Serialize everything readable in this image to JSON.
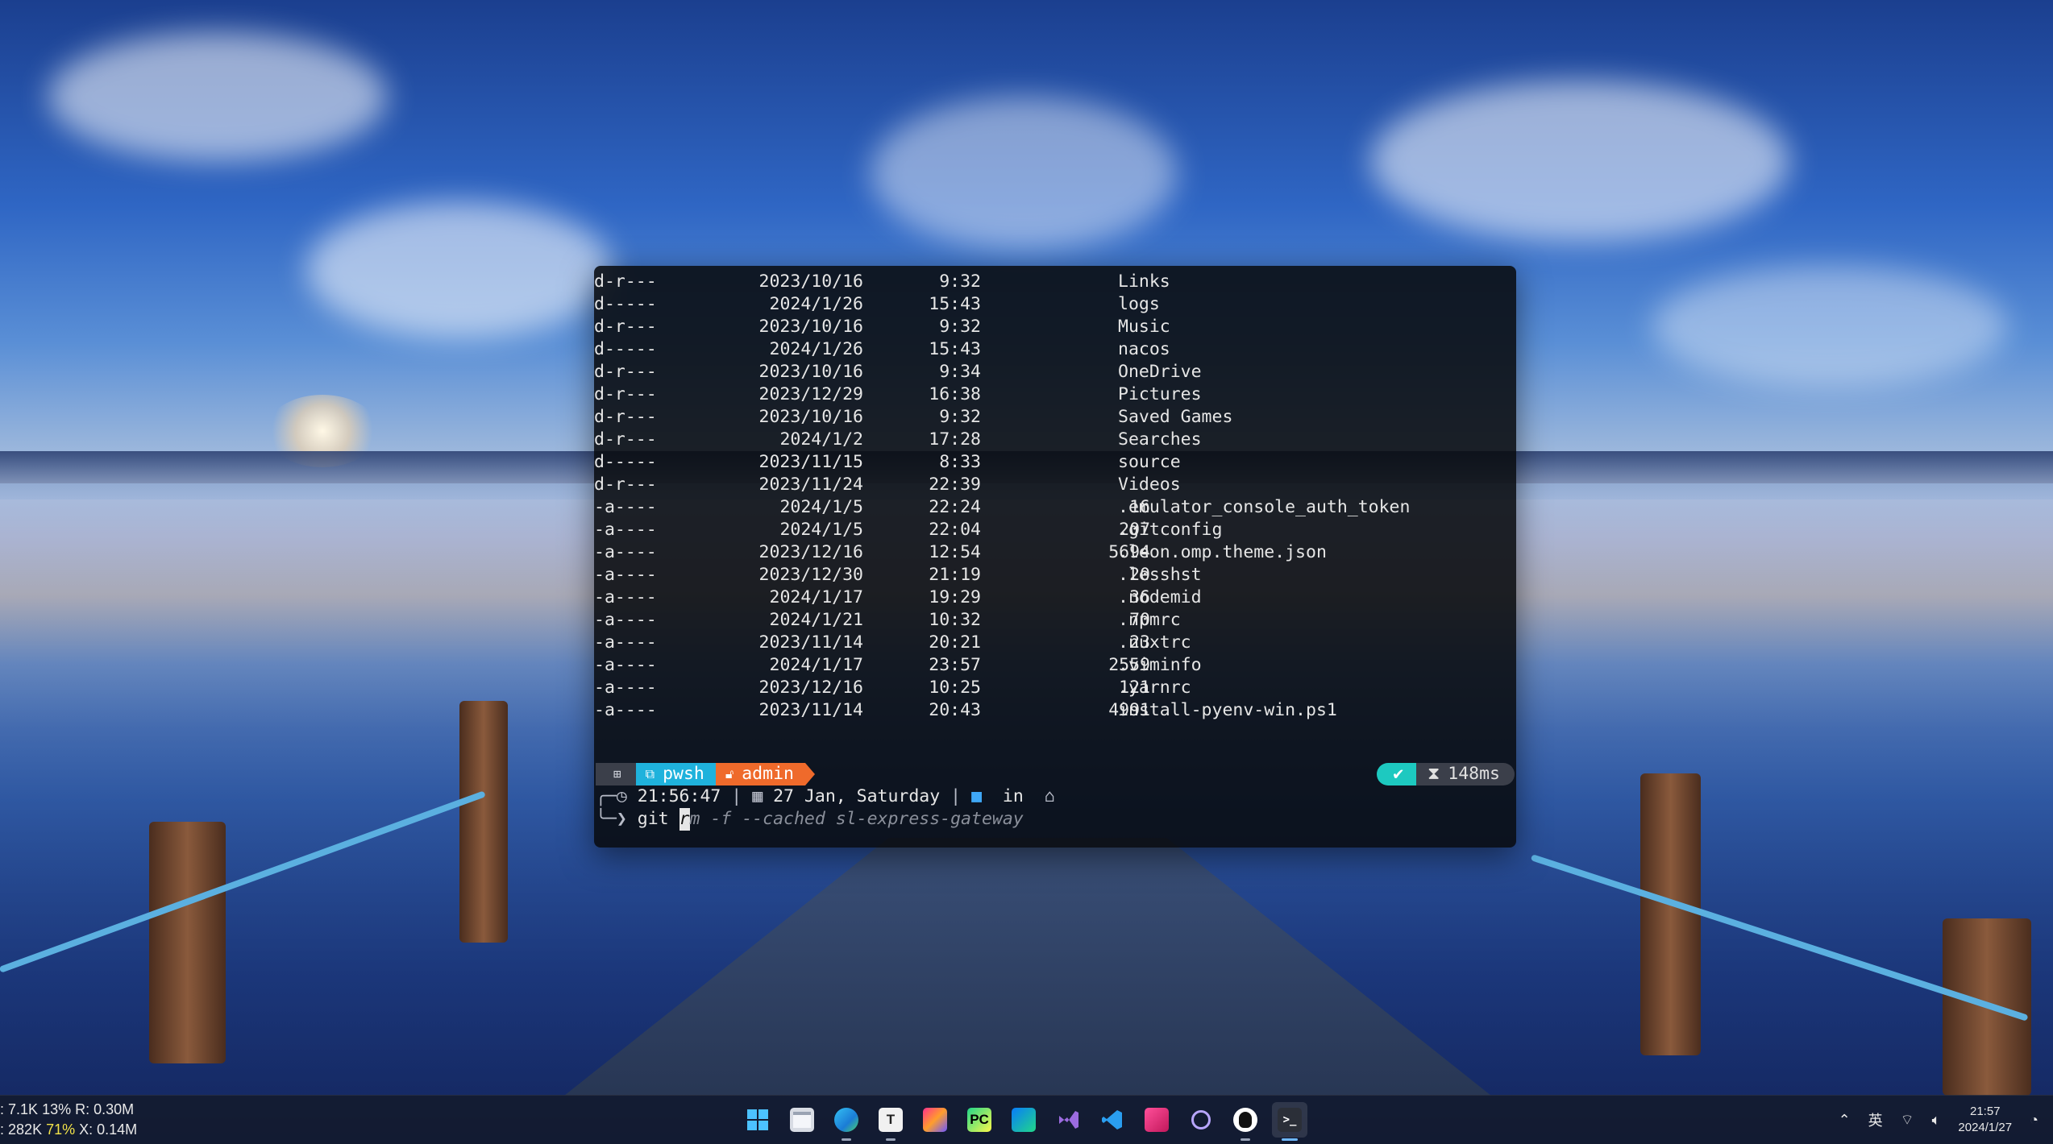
{
  "listing": [
    {
      "mode": "d-r---",
      "date": "2023/10/16",
      "time": "9:32",
      "length": "",
      "name": "Links"
    },
    {
      "mode": "d-----",
      "date": "2024/1/26",
      "time": "15:43",
      "length": "",
      "name": "logs"
    },
    {
      "mode": "d-r---",
      "date": "2023/10/16",
      "time": "9:32",
      "length": "",
      "name": "Music"
    },
    {
      "mode": "d-----",
      "date": "2024/1/26",
      "time": "15:43",
      "length": "",
      "name": "nacos"
    },
    {
      "mode": "d-r---",
      "date": "2023/10/16",
      "time": "9:34",
      "length": "",
      "name": "OneDrive"
    },
    {
      "mode": "d-r---",
      "date": "2023/12/29",
      "time": "16:38",
      "length": "",
      "name": "Pictures"
    },
    {
      "mode": "d-r---",
      "date": "2023/10/16",
      "time": "9:32",
      "length": "",
      "name": "Saved Games"
    },
    {
      "mode": "d-r---",
      "date": "2024/1/2",
      "time": "17:28",
      "length": "",
      "name": "Searches"
    },
    {
      "mode": "d-----",
      "date": "2023/11/15",
      "time": "8:33",
      "length": "",
      "name": "source"
    },
    {
      "mode": "d-r---",
      "date": "2023/11/24",
      "time": "22:39",
      "length": "",
      "name": "Videos"
    },
    {
      "mode": "-a----",
      "date": "2024/1/5",
      "time": "22:24",
      "length": "16",
      "name": ".emulator_console_auth_token"
    },
    {
      "mode": "-a----",
      "date": "2024/1/5",
      "time": "22:04",
      "length": "207",
      "name": ".gitconfig"
    },
    {
      "mode": "-a----",
      "date": "2023/12/16",
      "time": "12:54",
      "length": "5694",
      "name": ".leon.omp.theme.json"
    },
    {
      "mode": "-a----",
      "date": "2023/12/30",
      "time": "21:19",
      "length": "20",
      "name": ".lesshst"
    },
    {
      "mode": "-a----",
      "date": "2024/1/17",
      "time": "19:29",
      "length": "36",
      "name": ".nodemid"
    },
    {
      "mode": "-a----",
      "date": "2024/1/21",
      "time": "10:32",
      "length": "70",
      "name": ".npmrc"
    },
    {
      "mode": "-a----",
      "date": "2023/11/14",
      "time": "20:21",
      "length": "23",
      "name": ".nuxtrc"
    },
    {
      "mode": "-a----",
      "date": "2024/1/17",
      "time": "23:57",
      "length": "2559",
      "name": ".viminfo"
    },
    {
      "mode": "-a----",
      "date": "2023/12/16",
      "time": "10:25",
      "length": "121",
      "name": ".yarnrc"
    },
    {
      "mode": "-a----",
      "date": "2023/11/14",
      "time": "20:43",
      "length": "4991",
      "name": "install-pyenv-win.ps1"
    }
  ],
  "prompt": {
    "shell": "pwsh",
    "user": "admin",
    "status_duration": "148ms",
    "clock": "21:56:47",
    "sep1": "|",
    "date": "27 Jan, Saturday",
    "sep2": "|",
    "in_label": "in",
    "cmd_typed": "git ",
    "cursor_char": "r",
    "suggestion": "m -f --cached sl-express-gateway"
  },
  "netstat": {
    "line1_prefix": ":",
    "line1_a": "7.1K",
    "line1_pct": "13%",
    "line1_b": "R: 0.30M",
    "line2_prefix": ":",
    "line2_a": "282K",
    "line2_pct": "71%",
    "line2_b": "X: 0.14M"
  },
  "taskbar": {
    "apps": [
      {
        "icon": "windows-start-icon",
        "running": false
      },
      {
        "icon": "file-explorer-icon",
        "running": false
      },
      {
        "icon": "edge-browser-icon",
        "running": true
      },
      {
        "icon": "typora-icon",
        "label": "T",
        "running": true
      },
      {
        "icon": "jetbrains-toolbox-icon",
        "running": false
      },
      {
        "icon": "pycharm-icon",
        "label": "PC",
        "running": false
      },
      {
        "icon": "jetbrains-ide-icon",
        "running": false
      },
      {
        "icon": "visual-studio-icon",
        "running": false
      },
      {
        "icon": "vscode-icon",
        "running": false
      },
      {
        "icon": "obsidian-icon",
        "running": false
      },
      {
        "icon": "gear-app-icon",
        "running": false
      },
      {
        "icon": "qq-icon",
        "running": true
      },
      {
        "icon": "terminal-icon",
        "running": true,
        "active": true
      }
    ],
    "ime": "英",
    "time": "21:57",
    "date": "2024/1/27"
  },
  "colors": {
    "shell_seg": "#1fb2dc",
    "user_seg": "#ef6a2b",
    "ok_seg": "#1dc9c0",
    "folder_blue": "#3fa7f5"
  }
}
